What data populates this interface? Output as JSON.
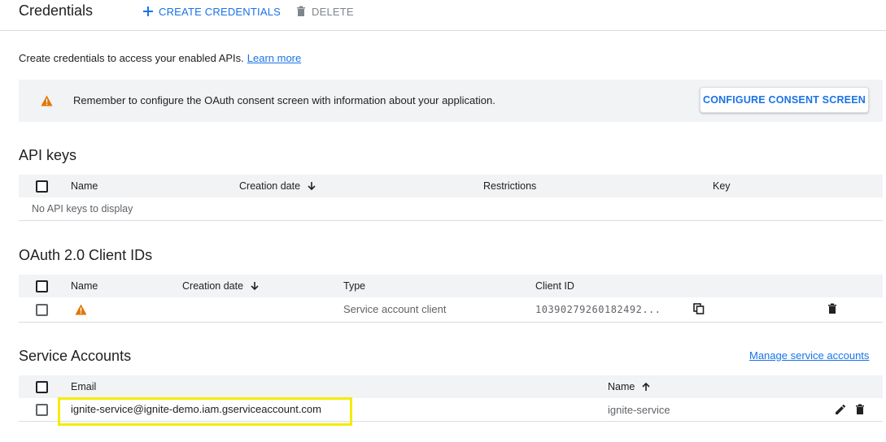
{
  "header": {
    "title": "Credentials",
    "create_label": "CREATE CREDENTIALS",
    "delete_label": "DELETE"
  },
  "intro": {
    "text": "Create credentials to access your enabled APIs.",
    "link": "Learn more"
  },
  "banner": {
    "message": "Remember to configure the OAuth consent screen with information about your application.",
    "button": "CONFIGURE CONSENT SCREEN"
  },
  "api_keys": {
    "title": "API keys",
    "columns": [
      "Name",
      "Creation date",
      "Restrictions",
      "Key"
    ],
    "empty": "No API keys to display"
  },
  "oauth": {
    "title": "OAuth 2.0 Client IDs",
    "columns": [
      "Name",
      "Creation date",
      "Type",
      "Client ID"
    ],
    "rows": [
      {
        "name": "",
        "type": "Service account client",
        "client_id": "10390279260182492..."
      }
    ]
  },
  "service_accounts": {
    "title": "Service Accounts",
    "manage_link": "Manage service accounts",
    "columns": [
      "Email",
      "Name"
    ],
    "rows": [
      {
        "email": "ignite-service@ignite-demo.iam.gserviceaccount.com",
        "name": "ignite-service"
      }
    ]
  },
  "colors": {
    "accent": "#1a73e8",
    "warning": "#e37400",
    "header_bg": "#f1f3f4",
    "highlight": "#f5eb00"
  },
  "icons": [
    "plus-icon",
    "trash-icon",
    "warning-icon",
    "arrow-down-icon",
    "arrow-up-icon",
    "copy-icon",
    "edit-icon"
  ]
}
